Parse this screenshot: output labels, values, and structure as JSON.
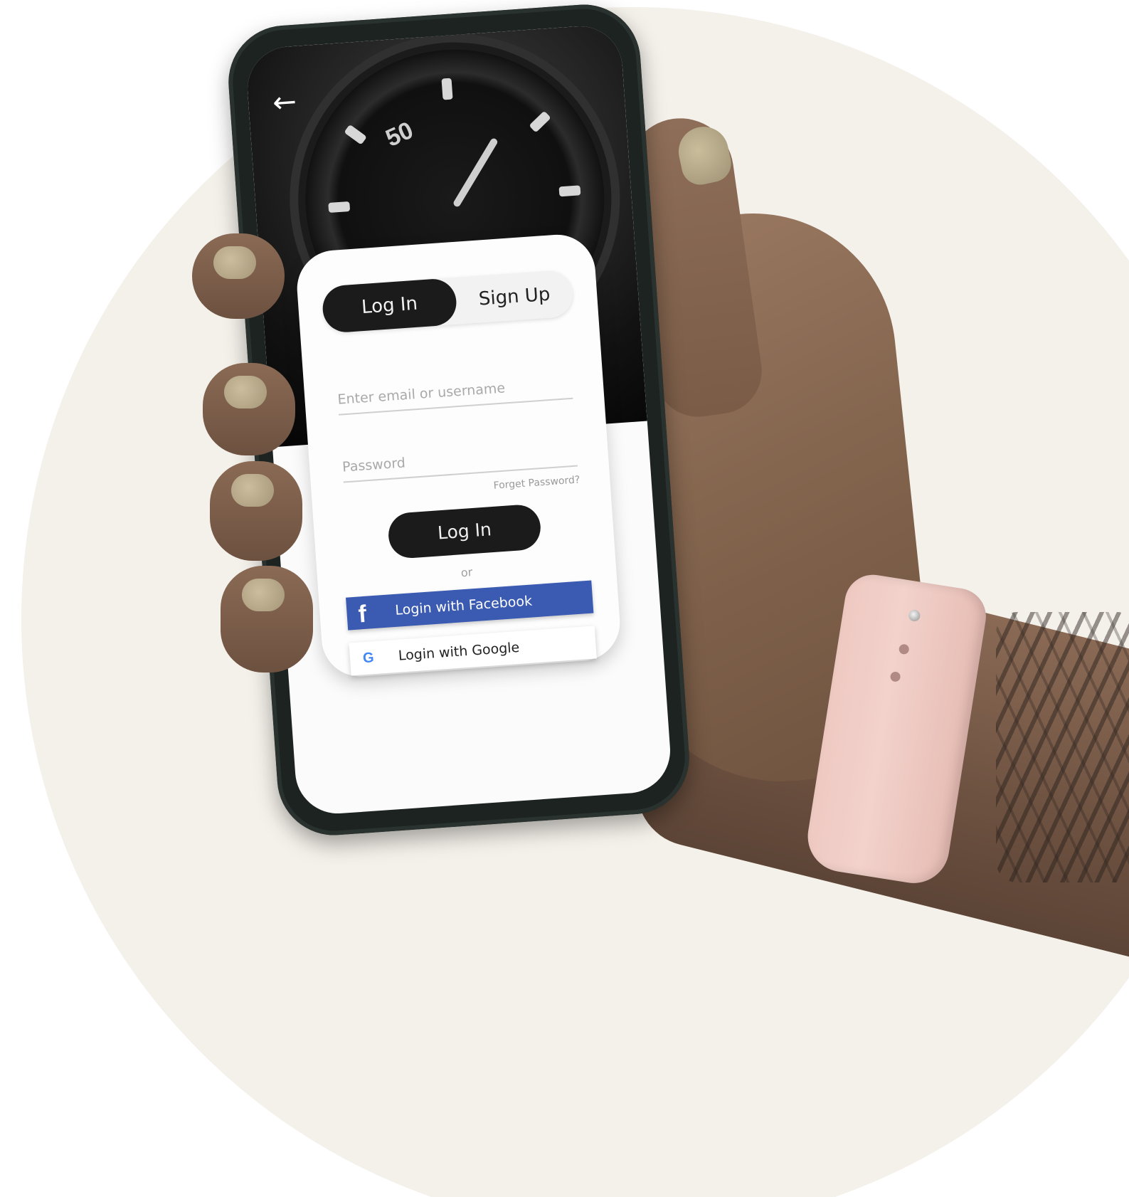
{
  "app": {
    "background_color": "#f4f0ea",
    "accent_dark": "#1b1b1b",
    "facebook_color": "#3b5ab1"
  },
  "header": {
    "back_icon": "arrow-left-icon",
    "back_glyph": "←"
  },
  "hero": {
    "watch_bezel_number": "50"
  },
  "tabs": {
    "login_label": "Log In",
    "signup_label": "Sign Up",
    "active": "Log In"
  },
  "form": {
    "email_placeholder": "Enter email or username",
    "email_value": "",
    "password_placeholder": "Password",
    "password_value": "",
    "forgot_label": "Forget Password?",
    "submit_label": "Log In",
    "divider_label": "or"
  },
  "social": {
    "facebook_icon": "facebook-icon",
    "facebook_glyph": "f",
    "facebook_label": "Login with Facebook",
    "google_icon": "google-icon",
    "google_glyph": "G",
    "google_label": "Login with Google"
  }
}
